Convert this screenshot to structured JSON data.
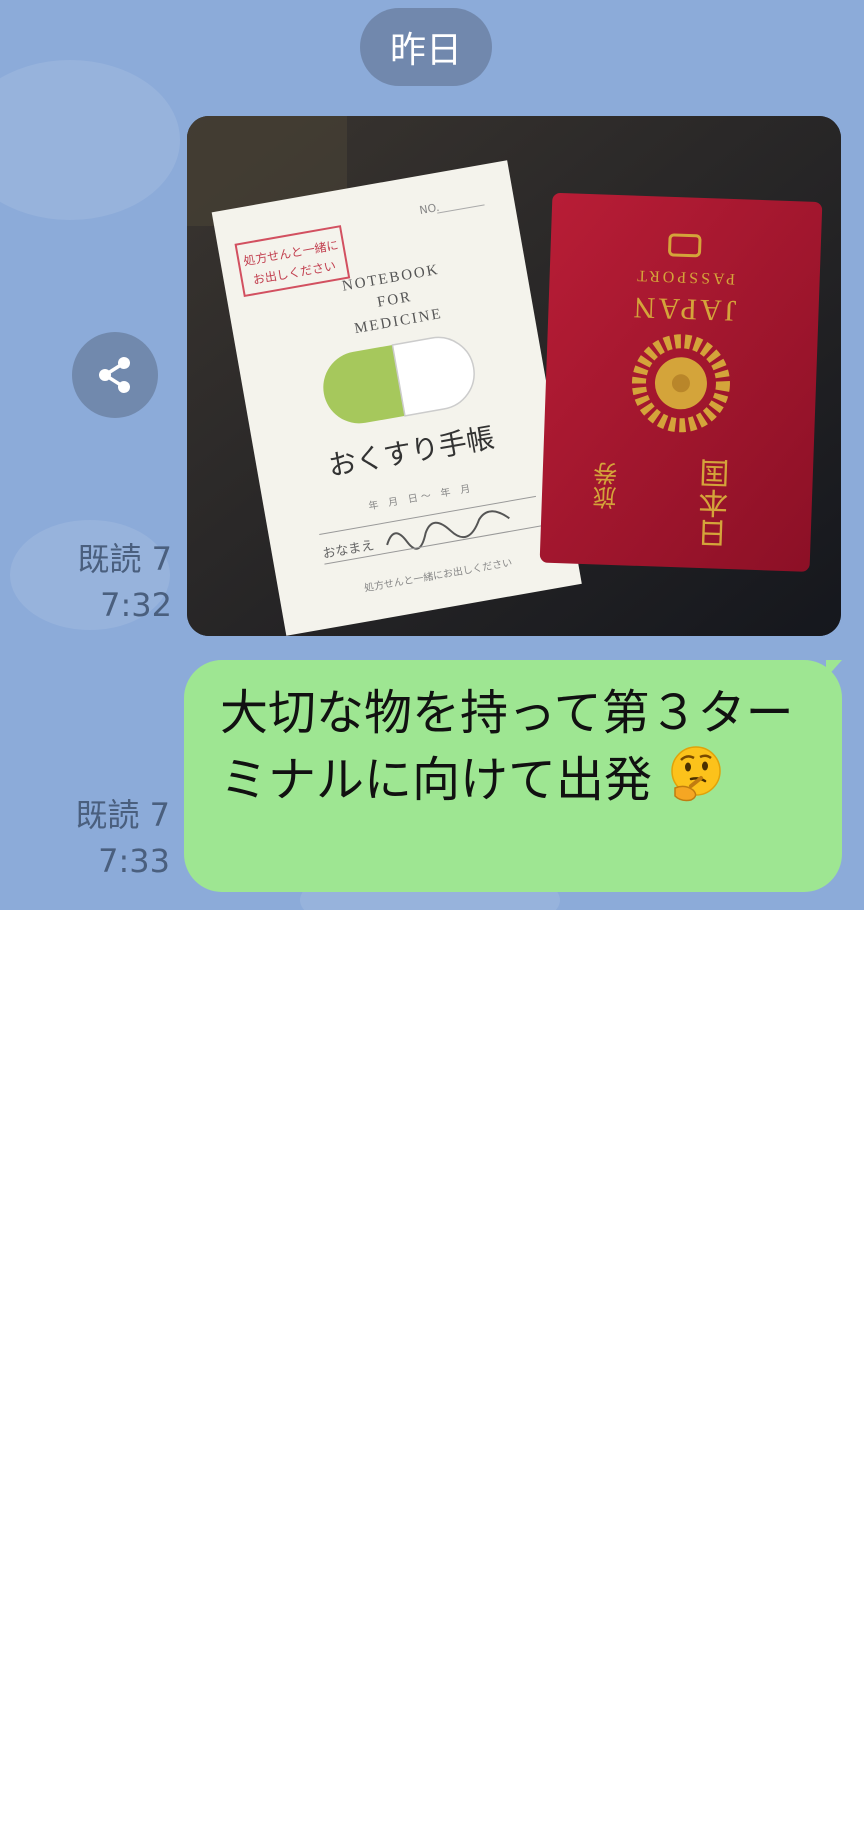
{
  "header": {
    "date_label": "昨日"
  },
  "messages": [
    {
      "type": "image",
      "read_status": "既読 7",
      "time": "7:32",
      "image": {
        "booklet": {
          "notice_stamp_line1": "処方せんと一緒に",
          "notice_stamp_line2": "お出しください",
          "no_label": "NO.",
          "title_en_line1": "NOTEBOOK",
          "title_en_line2": "FOR",
          "title_en_line3": "MEDICINE",
          "title_jp": "おくすり手帳",
          "date_labels": "年　月　日 〜　年　月",
          "name_label": "おなまえ",
          "footer": "処方せんと一緒にお出しください"
        },
        "passport": {
          "label_en_line1": "JAPAN",
          "label_en_line2": "PASSPORT",
          "label_jp_line1": "日本国",
          "label_jp_line2": "旅券"
        }
      }
    },
    {
      "type": "text",
      "read_status": "既読 7",
      "time": "7:33",
      "text": "大切な物を持って第３ターミナルに向けて出発",
      "emoji": "thinking-face"
    }
  ],
  "colors": {
    "chat_background": "#8cabd9",
    "date_pill": "#7188ad",
    "bubble_green": "#9ee692",
    "passport_red": "#a3162e"
  }
}
